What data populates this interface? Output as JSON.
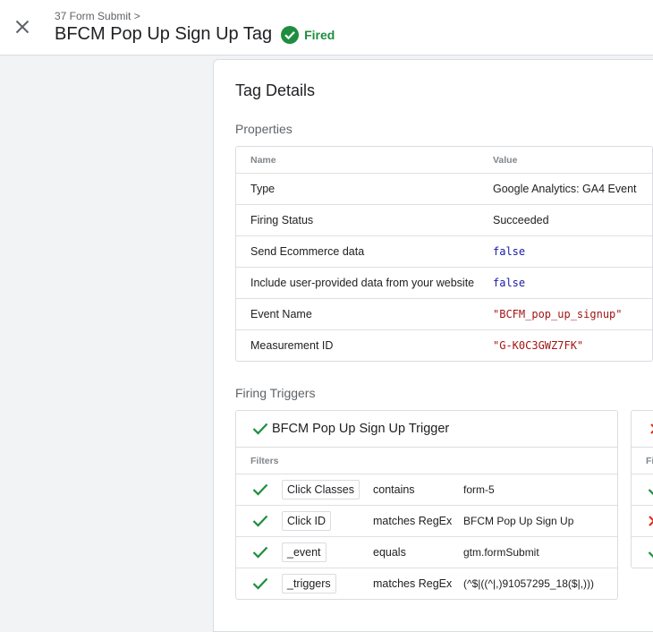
{
  "header": {
    "breadcrumb": "37 Form Submit >",
    "title": "BFCM Pop Up Sign Up Tag",
    "status": "Fired",
    "close_icon": "close-icon",
    "status_icon": "check-circle-icon"
  },
  "panel": {
    "title": "Tag Details",
    "properties_title": "Properties",
    "properties_columns": [
      "Name",
      "Value"
    ],
    "properties": [
      {
        "name": "Type",
        "value": "Google Analytics: GA4 Event",
        "style": "text"
      },
      {
        "name": "Firing Status",
        "value": "Succeeded",
        "style": "text"
      },
      {
        "name": "Send Ecommerce data",
        "value": "false",
        "style": "bool"
      },
      {
        "name": "Include user-provided data from your website",
        "value": "false",
        "style": "bool"
      },
      {
        "name": "Event Name",
        "value": "\"BCFM_pop_up_signup\"",
        "style": "string"
      },
      {
        "name": "Measurement ID",
        "value": "\"G-K0C3GWZ7FK\"",
        "style": "string"
      }
    ],
    "triggers_title": "Firing Triggers",
    "trigger": {
      "name": "BFCM Pop Up Sign Up Trigger",
      "filters_label": "Filters",
      "filters": [
        {
          "variable": "Click Classes",
          "operator": "contains",
          "value": "form-5",
          "passed": true
        },
        {
          "variable": "Click ID",
          "operator": "matches RegEx",
          "value": "BFCM Pop Up Sign Up",
          "passed": true
        },
        {
          "variable": "_event",
          "operator": "equals",
          "value": "gtm.formSubmit",
          "passed": true
        },
        {
          "variable": "_triggers",
          "operator": "matches RegEx",
          "value": "(^$|((^|,)91057295_18($|,)))",
          "passed": true
        }
      ]
    },
    "second_trigger": {
      "filters_label": "Fi",
      "results": [
        true,
        false,
        true
      ]
    }
  },
  "colors": {
    "success": "#1e8e3e",
    "fail": "#d93025",
    "bool": "#1a1aa6",
    "string": "#a31515"
  }
}
